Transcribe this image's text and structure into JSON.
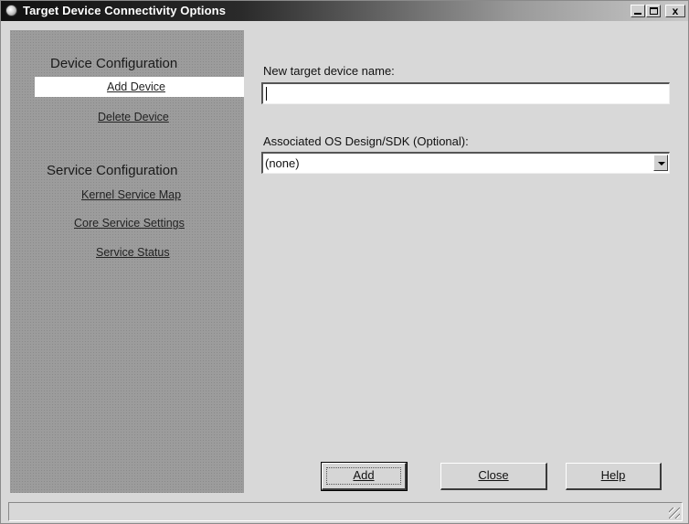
{
  "window": {
    "title": "Target Device Connectivity Options"
  },
  "nav": {
    "sections": [
      {
        "heading": "Device Configuration",
        "items": [
          {
            "label": "Add Device",
            "selected": true
          },
          {
            "label": "Delete Device",
            "selected": false
          }
        ]
      },
      {
        "heading": "Service Configuration",
        "items": [
          {
            "label": "Kernel Service Map",
            "selected": false
          },
          {
            "label": "Core Service Settings",
            "selected": false
          },
          {
            "label": "Service Status",
            "selected": false
          }
        ]
      }
    ]
  },
  "form": {
    "name_label": "New target device name:",
    "name_value": "",
    "os_label": "Associated OS Design/SDK (Optional):",
    "os_value": "(none)"
  },
  "buttons": {
    "add": "Add",
    "close": "Close",
    "help": "Help"
  },
  "icons": {
    "app": "app-icon",
    "minimize": "minimize-icon",
    "maximize": "maximize-icon",
    "close": "close-icon",
    "dropdown": "chevron-down-icon",
    "resize": "resize-grip-icon"
  }
}
